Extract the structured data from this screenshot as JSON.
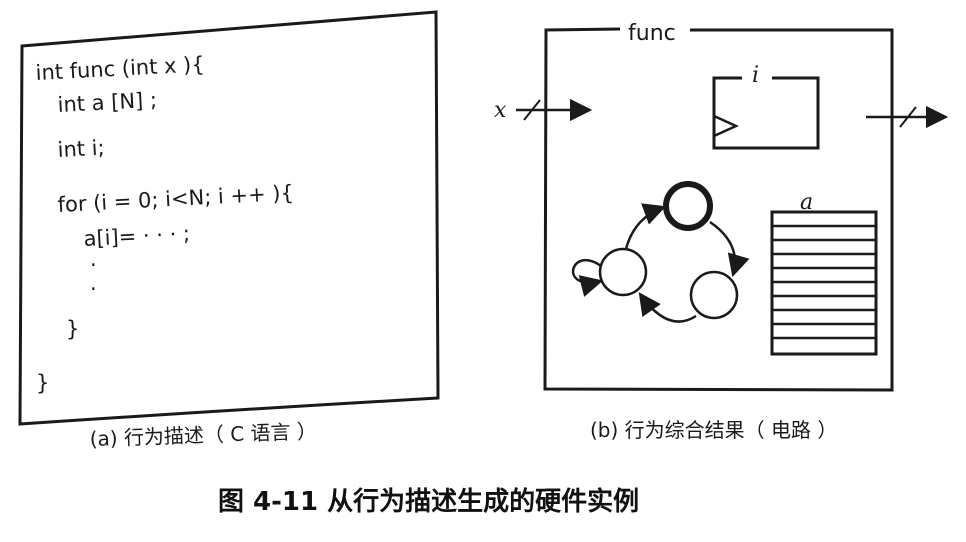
{
  "code_panel": {
    "lines": [
      "int func (int x ){",
      "int a [N] ;",
      "int i;",
      "for (i = 0; i<N; i ++ ){",
      "a[i]= · · · ;",
      "·",
      "·",
      "}",
      "}"
    ],
    "caption": "(a) 行为描述（ C 语言 ）"
  },
  "circuit_panel": {
    "module_name": "func",
    "input_label": "x",
    "register_label": "i",
    "memory_label": "a",
    "caption": "(b) 行为综合结果（ 电路 ）"
  },
  "figure_caption": "图 4-11 从行为描述生成的硬件实例"
}
